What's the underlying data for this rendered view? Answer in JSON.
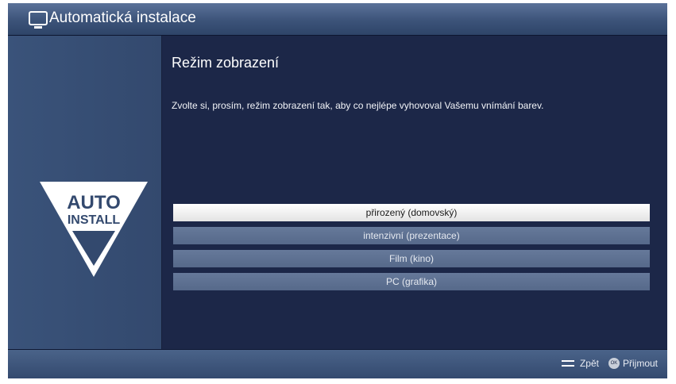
{
  "header": {
    "title": "Automatická instalace",
    "icon": "tv-icon"
  },
  "sidebar": {
    "logo_line1": "AUTO",
    "logo_line2": "INSTALL"
  },
  "main": {
    "heading": "Režim zobrazení",
    "description": "Zvolte si, prosím, režim zobrazení tak, aby co nejlépe vyhovoval Vašemu vnímání barev.",
    "options": [
      {
        "label": "přirozený (domovský)",
        "selected": true
      },
      {
        "label": "intenzivní (prezentace)",
        "selected": false
      },
      {
        "label": "Film (kino)",
        "selected": false
      },
      {
        "label": "PC (grafika)",
        "selected": false
      }
    ]
  },
  "footer": {
    "back_label": "Zpět",
    "ok_badge": "OK",
    "accept_label": "Přijmout"
  },
  "colors": {
    "background": "#1c2747",
    "sidebar": "#3a537a",
    "option": "#5f7293",
    "selected": "#ffffff"
  }
}
